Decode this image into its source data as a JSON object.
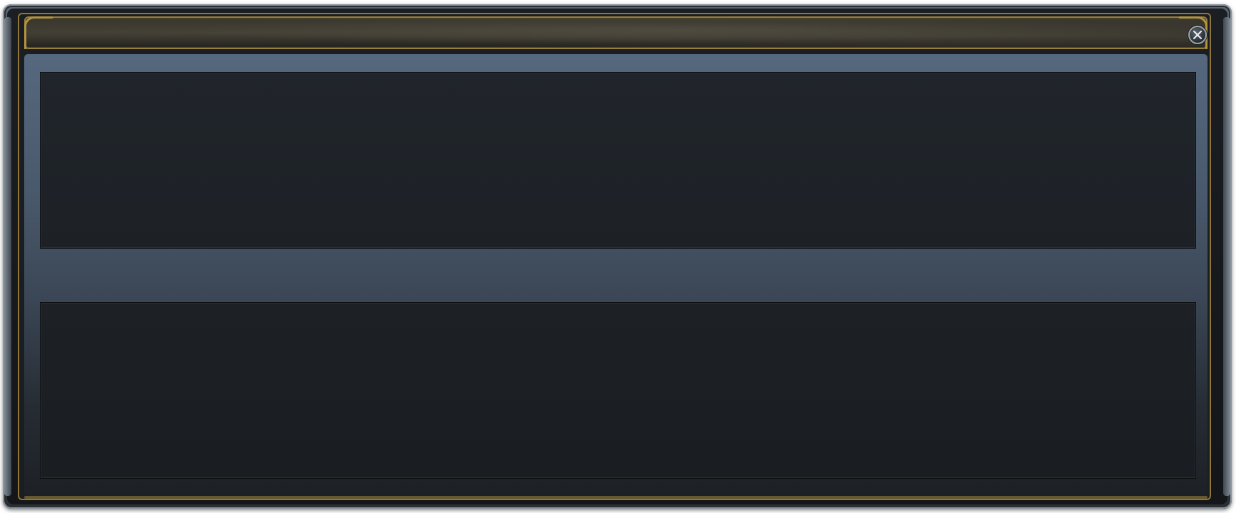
{
  "window": {
    "title": "",
    "colors": {
      "frame_gold": "#9a7f3c",
      "content_gradient_top": "#56687e",
      "panel_background": "#1e2227"
    }
  },
  "title_bar": {
    "close_icon": "close-icon"
  },
  "panels": {
    "top": {
      "content": ""
    },
    "bottom": {
      "content": ""
    }
  }
}
